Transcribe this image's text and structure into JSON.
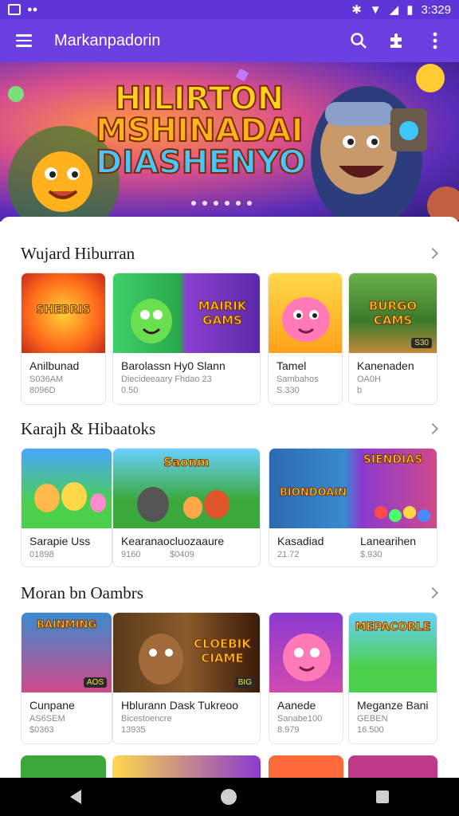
{
  "status": {
    "time": "3:329"
  },
  "app_bar": {
    "title": "Markanpadorin"
  },
  "banner": {
    "line1": "HILIRTON",
    "line2": "MSHINADAI",
    "line3": "DIASHENYO"
  },
  "sections": [
    {
      "title": "Wujard Hiburran",
      "cards": [
        {
          "thumb_text": "SHEBRIS",
          "badge": "",
          "name": "Anilbunad",
          "sub": "S036AM",
          "price": "8096D"
        },
        {
          "thumb_text": "MAIRIK GAMS",
          "badge": "",
          "name": "Barolassn Hy0 Slann",
          "sub": "Diecideeaary Fhdao 23",
          "price": "0.50"
        },
        {
          "thumb_text": "",
          "badge": "",
          "name": "Tamel",
          "sub": "Sambahos",
          "price": "S.330"
        },
        {
          "thumb_text": "BURGO CAMS",
          "badge": "S30",
          "name": "Kanenaden",
          "sub": "OA0H",
          "price": "b"
        }
      ]
    },
    {
      "title": "Karajh & Hibaatoks",
      "cards": [
        {
          "thumb_text": "",
          "badge": "",
          "name": "Sarapie Uss",
          "sub": "01898",
          "price": ""
        },
        {
          "thumb_text": "Saonm",
          "badge": "",
          "name": "Kearanaocluozaaure",
          "sub": "9160",
          "price": "$0409"
        },
        {
          "thumb_text": "BIONDOAIN",
          "badge": "",
          "name": "Kasadiad",
          "sub": "21.72",
          "price": ""
        },
        {
          "thumb_text": "SIENDIAS",
          "badge": "",
          "name": "Lanearihen",
          "sub": "$.930",
          "price": ""
        }
      ]
    },
    {
      "title": "Moran bn Oambrs",
      "cards": [
        {
          "thumb_text": "BAINMING",
          "badge": "AOS",
          "name": "Cunpane",
          "sub": "AS6SEM",
          "price": "$0363"
        },
        {
          "thumb_text": "CLOEBIK CIAME",
          "badge": "BIG",
          "name": "Hblurann Dask Tukreoo",
          "sub": "Bicestoencre",
          "price": "13935"
        },
        {
          "thumb_text": "",
          "badge": "",
          "name": "Aanede",
          "sub": "Sanabe100",
          "price": "8.979"
        },
        {
          "thumb_text": "MEPACORLE",
          "badge": "",
          "name": "Meganze Banik",
          "sub": "GEBEN",
          "price": "16.500"
        }
      ]
    }
  ]
}
